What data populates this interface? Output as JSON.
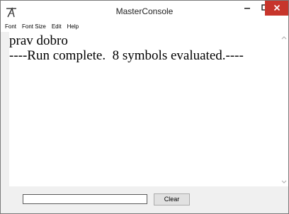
{
  "window": {
    "title": "MasterConsole",
    "icon": "app-icon",
    "controls": {
      "minimize": "−",
      "maximize": "□",
      "close": "✕"
    }
  },
  "menubar": {
    "items": [
      {
        "label": "Font"
      },
      {
        "label": "Font Size"
      },
      {
        "label": "Edit"
      },
      {
        "label": "Help"
      }
    ]
  },
  "console": {
    "lines": [
      "prav dobro",
      "----Run complete.  8 symbols evaluated.----"
    ]
  },
  "scrollbar": {
    "up_icon": "chevron-up-icon",
    "down_icon": "chevron-down-icon"
  },
  "command": {
    "input_value": "",
    "clear_label": "Clear"
  },
  "colors": {
    "close_button": "#c7352b",
    "window_bg": "#f0f0f0",
    "console_bg": "#ffffff"
  }
}
